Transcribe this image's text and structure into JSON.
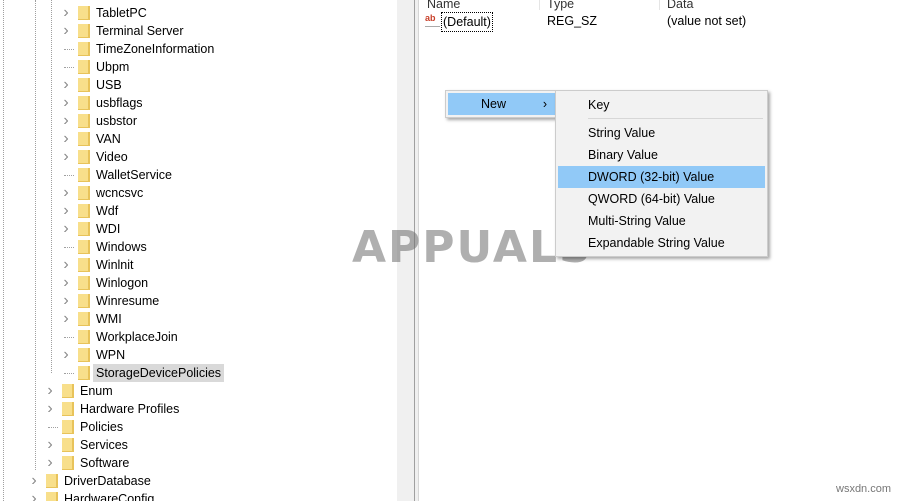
{
  "tree": {
    "items": [
      {
        "label": "TabletPC",
        "level": 3,
        "expandable": true
      },
      {
        "label": "Terminal Server",
        "level": 3,
        "expandable": true
      },
      {
        "label": "TimeZoneInformation",
        "level": 3,
        "expandable": false
      },
      {
        "label": "Ubpm",
        "level": 3,
        "expandable": false
      },
      {
        "label": "USB",
        "level": 3,
        "expandable": true
      },
      {
        "label": "usbflags",
        "level": 3,
        "expandable": true
      },
      {
        "label": "usbstor",
        "level": 3,
        "expandable": true
      },
      {
        "label": "VAN",
        "level": 3,
        "expandable": true
      },
      {
        "label": "Video",
        "level": 3,
        "expandable": true
      },
      {
        "label": "WalletService",
        "level": 3,
        "expandable": false
      },
      {
        "label": "wcncsvc",
        "level": 3,
        "expandable": true
      },
      {
        "label": "Wdf",
        "level": 3,
        "expandable": true
      },
      {
        "label": "WDI",
        "level": 3,
        "expandable": true
      },
      {
        "label": "Windows",
        "level": 3,
        "expandable": false
      },
      {
        "label": "Winlnit",
        "level": 3,
        "expandable": true
      },
      {
        "label": "Winlogon",
        "level": 3,
        "expandable": true
      },
      {
        "label": "Winresume",
        "level": 3,
        "expandable": true
      },
      {
        "label": "WMI",
        "level": 3,
        "expandable": true
      },
      {
        "label": "WorkplaceJoin",
        "level": 3,
        "expandable": false
      },
      {
        "label": "WPN",
        "level": 3,
        "expandable": true
      },
      {
        "label": "StorageDevicePolicies",
        "level": 3,
        "expandable": false,
        "selected": true
      },
      {
        "label": "Enum",
        "level": 2,
        "expandable": true
      },
      {
        "label": "Hardware Profiles",
        "level": 2,
        "expandable": true
      },
      {
        "label": "Policies",
        "level": 2,
        "expandable": false
      },
      {
        "label": "Services",
        "level": 2,
        "expandable": true
      },
      {
        "label": "Software",
        "level": 2,
        "expandable": true
      },
      {
        "label": "DriverDatabase",
        "level": 1,
        "expandable": true
      },
      {
        "label": "HardwareConfig",
        "level": 1,
        "expandable": true
      }
    ]
  },
  "values": {
    "columns": [
      "Name",
      "Type",
      "Data"
    ],
    "rows": [
      {
        "name": "(Default)",
        "type": "REG_SZ",
        "data": "(value not set)",
        "icon": "string-value-icon"
      }
    ]
  },
  "context_menu": {
    "new_label": "New",
    "submenu_arrow": "›",
    "submenu": [
      {
        "label": "Key"
      },
      {
        "label": "String Value"
      },
      {
        "label": "Binary Value"
      },
      {
        "label": "DWORD (32-bit) Value",
        "highlighted": true
      },
      {
        "label": "QWORD (64-bit) Value"
      },
      {
        "label": "Multi-String Value"
      },
      {
        "label": "Expandable String Value"
      }
    ],
    "highlight_color": "#91c9f7"
  },
  "watermarks": {
    "brand": "APPUALS",
    "site": "wsxdn.com"
  }
}
